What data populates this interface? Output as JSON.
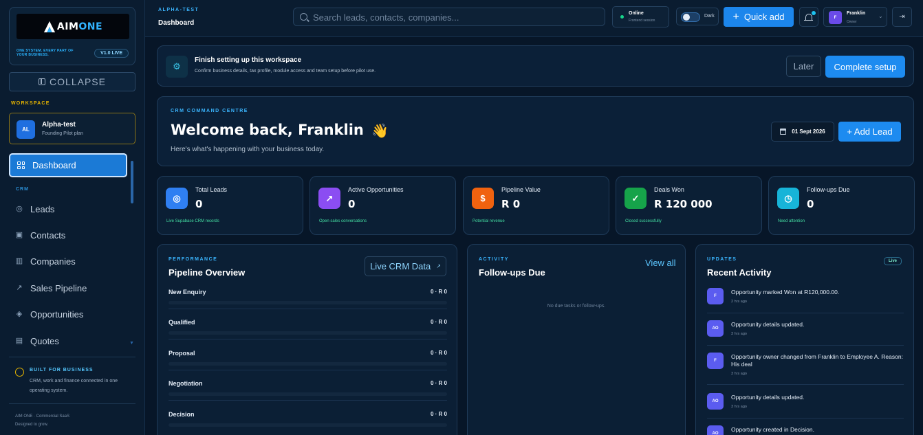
{
  "sidebar": {
    "logo_text_a": "AIM",
    "logo_text_b": "ONE",
    "tagline": "ONE SYSTEM. EVERY PART OF YOUR BUSINESS.",
    "version": "V1.0 LIVE",
    "collapse_label": "COLLAPSE",
    "workspace_label": "WORKSPACE",
    "workspace": {
      "initials": "AL",
      "name": "Alpha-test",
      "plan": "Founding Pilot plan"
    },
    "active_item": {
      "label": "Dashboard",
      "icon": "grid-icon"
    },
    "section_label": "CRM",
    "items": [
      {
        "label": "Leads",
        "icon": "target-icon"
      },
      {
        "label": "Contacts",
        "icon": "contact-card-icon"
      },
      {
        "label": "Companies",
        "icon": "building-icon"
      },
      {
        "label": "Sales Pipeline",
        "icon": "trend-icon"
      },
      {
        "label": "Opportunities",
        "icon": "tag-icon"
      },
      {
        "label": "Quotes",
        "icon": "document-icon"
      }
    ],
    "built_title": "BUILT FOR BUSINESS",
    "built_text": "CRM, work and finance connected in one operating system.",
    "footer_line1": "AIM ONE · Commercial SaaS",
    "footer_line2": "Designed to grow."
  },
  "header": {
    "workspace_kicker": "ALPHA-TEST",
    "page_title": "Dashboard",
    "search_placeholder": "Search leads, contacts, companies...",
    "status_main": "Online",
    "status_sub": "Frontend session",
    "theme_label": "Dark",
    "quick_add_label": "Quick add",
    "user": {
      "initial": "F",
      "name": "Franklin",
      "role": "Owner"
    }
  },
  "setup_banner": {
    "title": "Finish setting up this workspace",
    "subtitle": "Confirm business details, tax profile, module access and team setup before pilot use.",
    "later_label": "Later",
    "complete_label": "Complete setup"
  },
  "welcome": {
    "kicker": "CRM COMMAND CENTRE",
    "title": "Welcome back, Franklin",
    "emoji": "👋",
    "subtitle": "Here's what's happening with your business today.",
    "date": "01 Sept 2026",
    "add_lead_label": "+ Add Lead"
  },
  "stats": [
    {
      "label": "Total Leads",
      "value": "0",
      "note": "Live Supabase CRM records",
      "icon": "target-icon",
      "color": "#2f7ff2"
    },
    {
      "label": "Active Opportunities",
      "value": "0",
      "note": "Open sales conversations",
      "icon": "trend-up-icon",
      "color": "#8b4df2"
    },
    {
      "label": "Pipeline Value",
      "value": "R 0",
      "note": "Potential revenue",
      "icon": "dollar-icon",
      "color": "#f0620f"
    },
    {
      "label": "Deals Won",
      "value": "R 120 000",
      "note": "Closed successfully",
      "icon": "check-circle-icon",
      "color": "#16a34a"
    },
    {
      "label": "Follow-ups Due",
      "value": "0",
      "note": "Need attention",
      "icon": "clock-icon",
      "color": "#17b4d8"
    }
  ],
  "pipeline": {
    "kicker": "PERFORMANCE",
    "title": "Pipeline Overview",
    "button_label": "Live CRM Data",
    "stages": [
      {
        "name": "New Enquiry",
        "value": "0 · R 0",
        "fill": 0
      },
      {
        "name": "Qualified",
        "value": "0 · R 0",
        "fill": 0
      },
      {
        "name": "Proposal",
        "value": "0 · R 0",
        "fill": 0
      },
      {
        "name": "Negotiation",
        "value": "0 · R 0",
        "fill": 0
      },
      {
        "name": "Decision",
        "value": "0 · R 0",
        "fill": 0
      }
    ]
  },
  "followups": {
    "kicker": "ACTIVITY",
    "title": "Follow-ups Due",
    "view_all": "View all",
    "empty": "No due tasks or follow-ups."
  },
  "updates": {
    "kicker": "UPDATES",
    "title": "Recent Activity",
    "badge": "Live",
    "items": [
      {
        "initials": "F",
        "text": "Opportunity marked Won at R120,000.00.",
        "time": "2 hrs ago"
      },
      {
        "initials": "AO",
        "text": "Opportunity details updated.",
        "time": "3 hrs ago"
      },
      {
        "initials": "F",
        "text": "Opportunity owner changed from Franklin to Employee A. Reason: His deal",
        "time": "3 hrs ago"
      },
      {
        "initials": "AO",
        "text": "Opportunity details updated.",
        "time": "3 hrs ago"
      },
      {
        "initials": "AO",
        "text": "Opportunity created in Decision.",
        "time": ""
      }
    ]
  },
  "colors": {
    "accent": "#1d8bf0",
    "background": "#071628",
    "workspace_border": "#8a7418",
    "success": "#45e0a4"
  }
}
